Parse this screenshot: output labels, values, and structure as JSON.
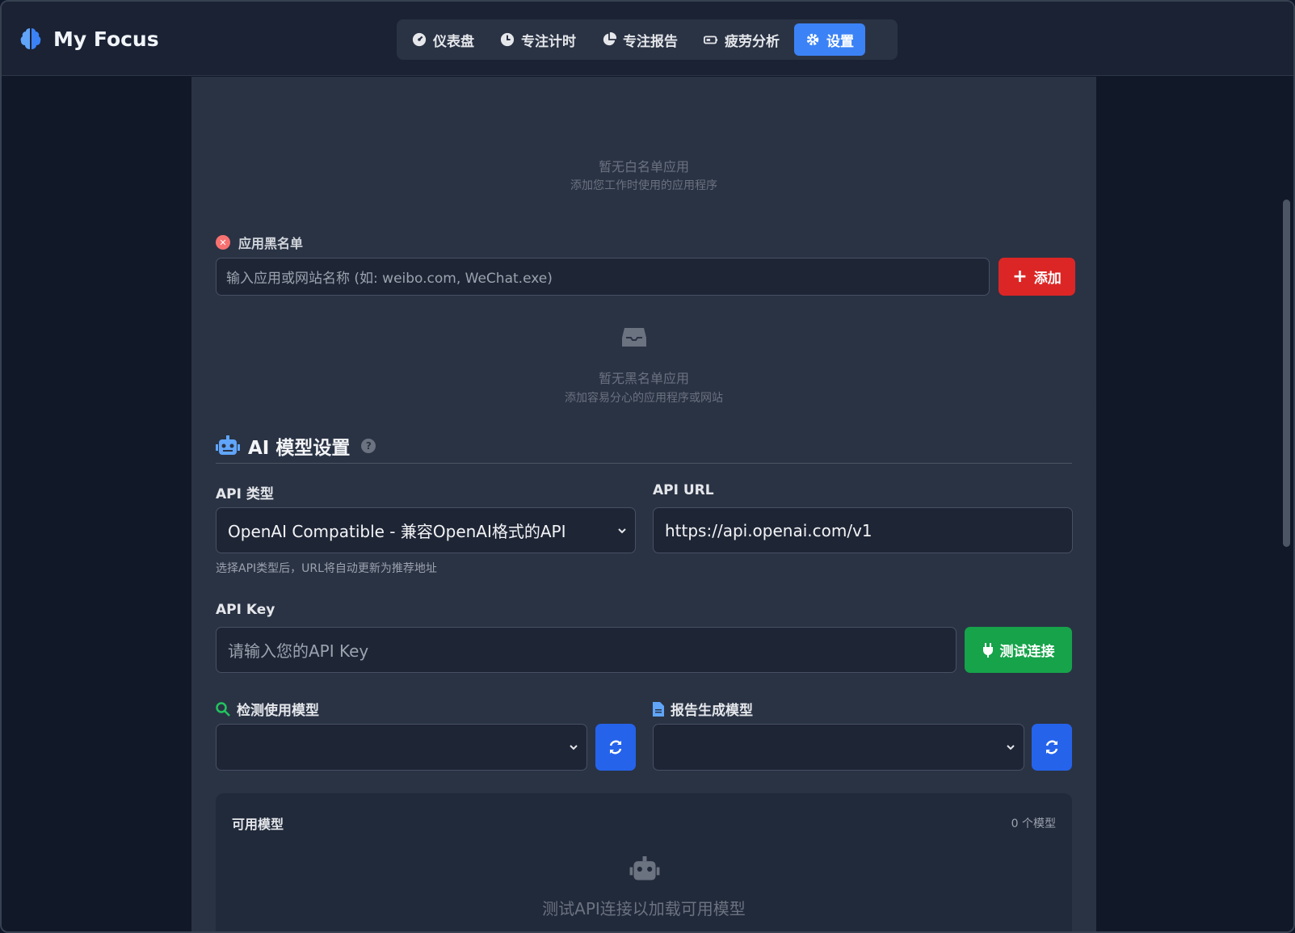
{
  "app": {
    "title": "My Focus"
  },
  "nav": {
    "items": [
      {
        "label": "仪表盘",
        "icon": "gauge-icon"
      },
      {
        "label": "专注计时",
        "icon": "clock-icon"
      },
      {
        "label": "专注报告",
        "icon": "pie-chart-icon"
      },
      {
        "label": "疲劳分析",
        "icon": "battery-icon"
      },
      {
        "label": "设置",
        "icon": "gear-icon",
        "active": true
      }
    ]
  },
  "whitelist": {
    "empty_title": "暂无白名单应用",
    "empty_sub": "添加您工作时使用的应用程序"
  },
  "blacklist": {
    "label": "应用黑名单",
    "placeholder": "输入应用或网站名称 (如: weibo.com, WeChat.exe)",
    "add_label": "添加",
    "empty_title": "暂无黑名单应用",
    "empty_sub": "添加容易分心的应用程序或网站"
  },
  "ai": {
    "title": "AI 模型设置",
    "api_type_label": "API 类型",
    "api_type_value": "OpenAI Compatible - 兼容OpenAI格式的API",
    "api_type_hint": "选择API类型后，URL将自动更新为推荐地址",
    "api_url_label": "API URL",
    "api_url_value": "https://api.openai.com/v1",
    "api_key_label": "API Key",
    "api_key_placeholder": "请输入您的API Key",
    "test_label": "测试连接",
    "detect_model_label": "检测使用模型",
    "report_model_label": "报告生成模型",
    "available_label": "可用模型",
    "available_count": "0 个模型",
    "available_empty": "测试API连接以加载可用模型"
  },
  "colors": {
    "accent": "#3b82f6",
    "danger": "#dc2626",
    "success": "#16a34a",
    "card": "#2a3344"
  }
}
